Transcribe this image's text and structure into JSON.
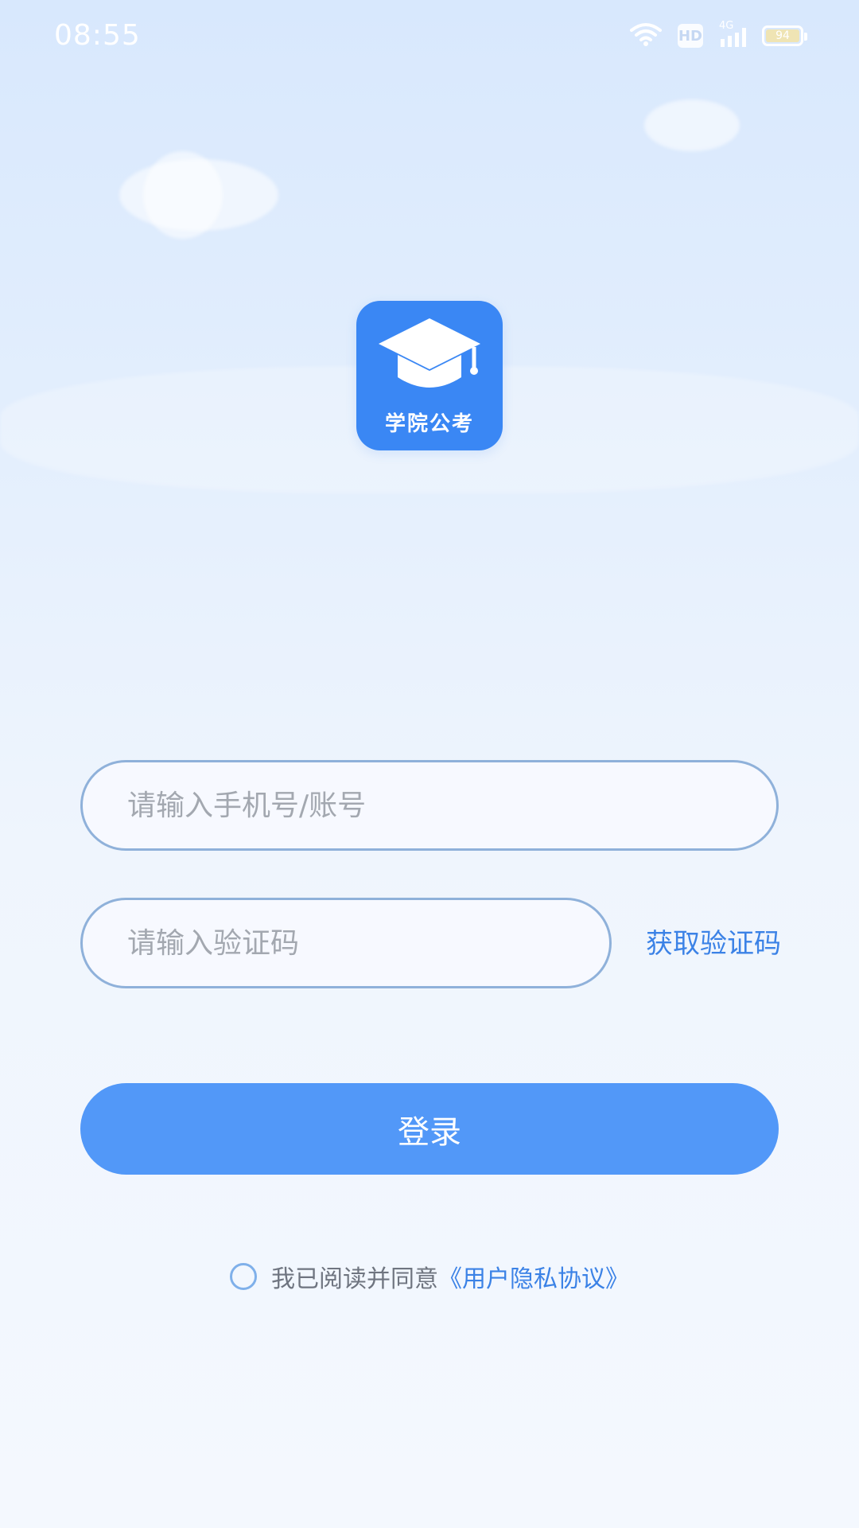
{
  "status_bar": {
    "time": "08:55",
    "icons": [
      "wifi-icon",
      "hd-icon",
      "signal-4g-icon",
      "battery-icon"
    ],
    "hd_label": "HD",
    "network_label": "4G",
    "battery_level": "94"
  },
  "logo": {
    "icon": "graduation-cap-icon",
    "text": "学院公考",
    "background_color": "#3a87f4"
  },
  "form": {
    "phone_placeholder": "请输入手机号/账号",
    "phone_value": "",
    "code_placeholder": "请输入验证码",
    "code_value": "",
    "get_code_label": "获取验证码",
    "login_label": "登录"
  },
  "agreement": {
    "checked": false,
    "text": "我已阅读并同意",
    "link": "《用户隐私协议》"
  },
  "colors": {
    "accent": "#5298f8",
    "link": "#3b82e6",
    "input_border": "#8fb1da"
  }
}
